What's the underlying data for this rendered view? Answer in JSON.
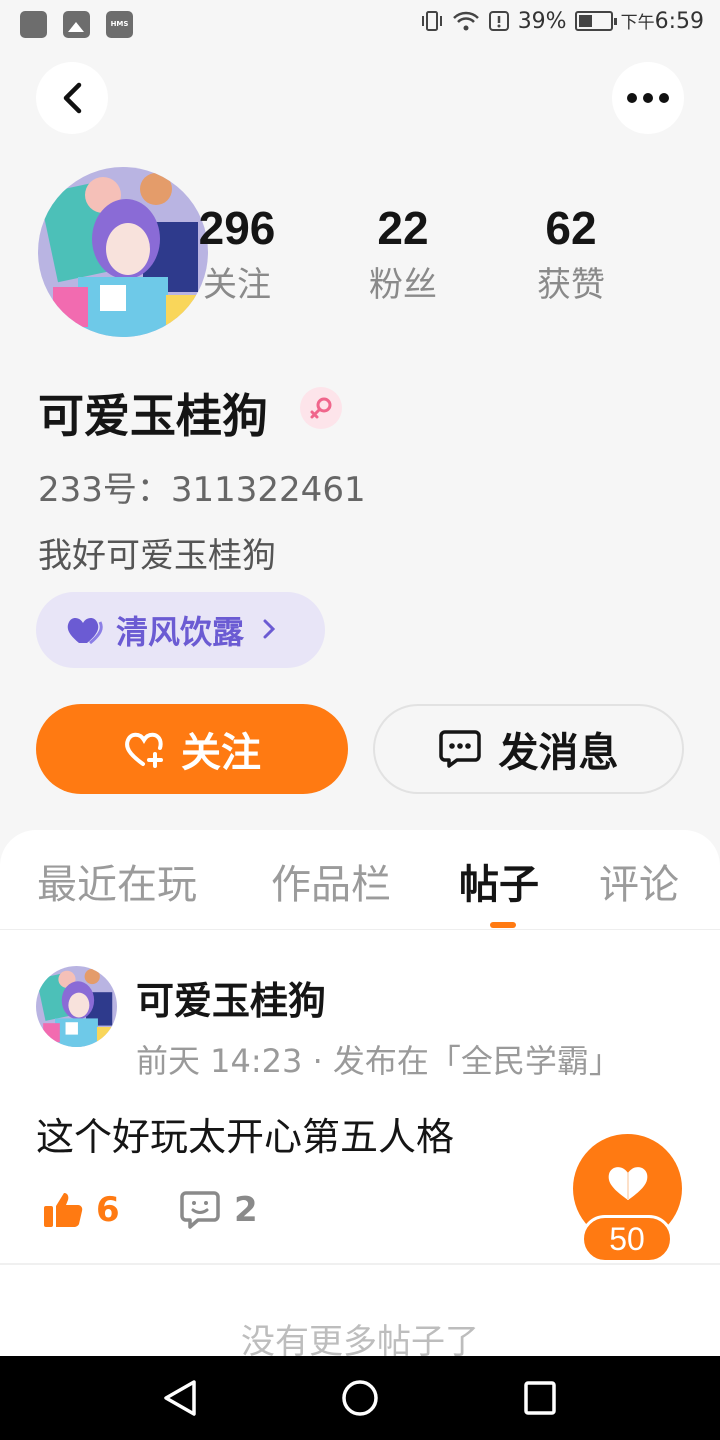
{
  "status_bar": {
    "notif_icons": [
      "app-icon",
      "image-icon",
      "hms-icon"
    ],
    "hms_label": "HMS",
    "battery": "39%",
    "time_prefix": "下午",
    "time": "6:59"
  },
  "header": {
    "back_icon": "chevron-left-icon",
    "more_icon": "more-dots-icon"
  },
  "profile": {
    "stats": [
      {
        "value": "296",
        "label": "关注"
      },
      {
        "value": "22",
        "label": "粉丝"
      },
      {
        "value": "62",
        "label": "获赞"
      }
    ],
    "name": "可爱玉桂狗",
    "gender_icon": "female-icon",
    "uid": "233号：311322461",
    "bio": "我好可爱玉桂狗",
    "tag": "清风饮露"
  },
  "actions": {
    "follow": "关注",
    "message": "发消息"
  },
  "tabs": [
    "最近在玩",
    "作品栏",
    "帖子",
    "评论"
  ],
  "active_tab": "帖子",
  "post": {
    "author": "可爱玉桂狗",
    "meta": "前天 14:23 · 发布在「全民学霸」",
    "content": "这个好玩太开心第五人格",
    "likes": "6",
    "comments": "2"
  },
  "fab": {
    "count": "50",
    "icon": "heart-icon"
  },
  "end_text": "没有更多帖子了",
  "colors": {
    "accent": "#ff7a12",
    "tag_bg": "#e8e5f7",
    "tag_text": "#6b5bd3",
    "gender": "#f0668c"
  }
}
